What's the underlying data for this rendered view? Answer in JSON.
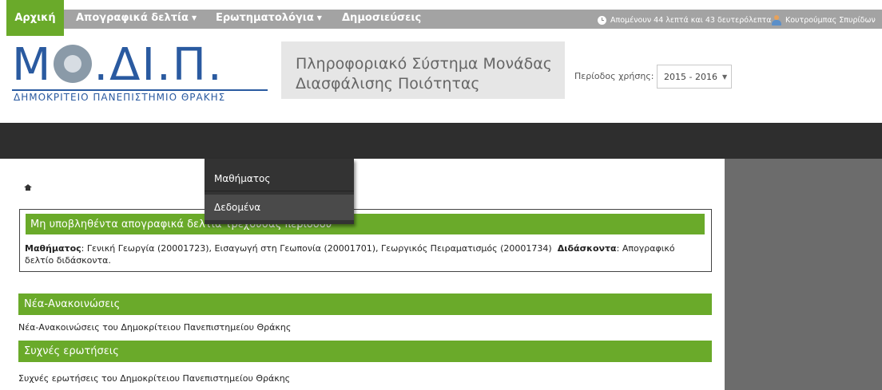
{
  "topbar": {
    "session_timer": "Απομένουν 44 λεπτά και 43 δευτερόλεπτα",
    "user_name": "Κουτρούμπας Σπυρίδων"
  },
  "header": {
    "logo_main": "Μ",
    "logo_rest": ".ΔΙ.Π.",
    "logo_subtitle": "ΔΗΜΟΚΡΙΤΕΙΟ ΠΑΝΕΠΙΣΤΗΜΙΟ ΘΡΑΚΗΣ",
    "system_title_line1": "Πληροφοριακό Σύστημα Μονάδας",
    "system_title_line2": "Διασφάλισης Ποιότητας",
    "period_label": "Περίοδος χρήσης:",
    "period_value": "2015 - 2016"
  },
  "nav": {
    "home": "Αρχική",
    "inventory": "Απογραφικά δελτία",
    "questionnaires": "Ερωτηματολόγια",
    "publications": "Δημοσιεύσεις"
  },
  "dropdown": {
    "items": [
      "Μαθήματος",
      "Δεδομένα"
    ]
  },
  "notice": {
    "title": "Μη υποβληθέντα απογραφικά δελτία τρέχουσας περιόδου",
    "courses_label": "Μαθήματος",
    "courses_text": ": Γενική Γεωργία (20001723), Εισαγωγή στη Γεωπονία (20001701), Γεωργικός Πειραματισμός (20001734)",
    "teachers_label": "Διδάσκοντα",
    "teachers_text": ": Απογραφικό δελτίο διδάσκοντα."
  },
  "news": {
    "title": "Νέα-Ανακοινώσεις",
    "text": "Νέα-Ανακοινώσεις του Δημοκρίτειου Πανεπιστημείου Θράκης"
  },
  "faq": {
    "title": "Συχνές ερωτήσεις",
    "text": "Συχνές ερωτήσεις του Δημοκρίτειου Πανεπιστημείου Θράκης"
  },
  "colors": {
    "accent_green": "#6aaa2a",
    "navbar": "#2e2e2e",
    "logo_blue": "#2a5aa0"
  }
}
